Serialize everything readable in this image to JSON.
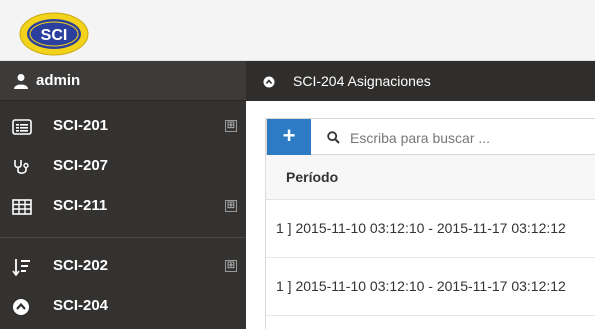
{
  "app": {
    "logo_text": "SCI"
  },
  "sidebar": {
    "user": {
      "name": "admin"
    },
    "items": [
      {
        "label": "SCI-201",
        "icon": "list-icon",
        "expandable": true
      },
      {
        "label": "SCI-207",
        "icon": "stethoscope-icon",
        "expandable": false
      },
      {
        "label": "SCI-211",
        "icon": "table-icon",
        "expandable": true
      },
      {
        "label": "SCI-202",
        "icon": "sort-desc-icon",
        "expandable": true
      },
      {
        "label": "SCI-204",
        "icon": "chevron-circle-up-icon",
        "expandable": false
      }
    ],
    "expand_glyph": "⊞"
  },
  "main": {
    "title": "SCI-204 Asignaciones",
    "add_label": "+",
    "search": {
      "placeholder": "Escriba para buscar ..."
    },
    "table": {
      "columns": [
        "Período"
      ],
      "rows": [
        {
          "periodo": "1 ] 2015-11-10 03:12:10 - 2015-11-17 03:12:12"
        },
        {
          "periodo": "1 ] 2015-11-10 03:12:10 - 2015-11-17 03:12:12"
        }
      ]
    }
  },
  "colors": {
    "sidebar_bg": "#333231",
    "header_bg": "#2f2e2d",
    "accent": "#2d7bc4",
    "logo_yellow": "#f2d21a",
    "logo_blue": "#2a3f9e"
  }
}
